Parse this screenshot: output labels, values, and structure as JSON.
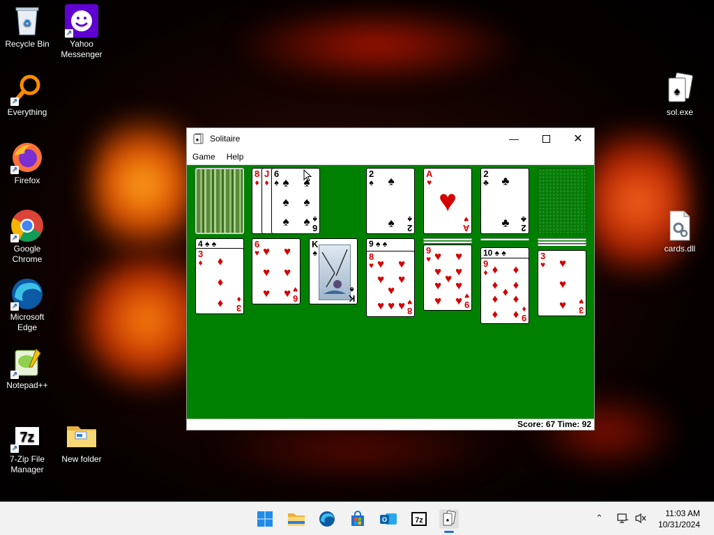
{
  "desktop": {
    "icons": [
      {
        "label": "Recycle Bin"
      },
      {
        "label": "Yahoo Messenger"
      },
      {
        "label": "Everything"
      },
      {
        "label": "Firefox"
      },
      {
        "label": "Google Chrome"
      },
      {
        "label": "Microsoft Edge"
      },
      {
        "label": "Notepad++"
      },
      {
        "label": "7-Zip File Manager"
      },
      {
        "label": "New folder"
      },
      {
        "label": "sol.exe"
      },
      {
        "label": "cards.dll"
      }
    ]
  },
  "window": {
    "title": "Solitaire",
    "menu": [
      "Game",
      "Help"
    ],
    "status": "Score: 67 Time: 92",
    "felt_color": "#008000"
  },
  "cards": {
    "waste": [
      {
        "rank": "8",
        "suit": "♦"
      },
      {
        "rank": "J",
        "suit": "♦"
      },
      {
        "rank": "6",
        "suit": "♠"
      }
    ],
    "foundations": [
      {
        "rank": "2",
        "suit": "♠"
      },
      {
        "rank": "A",
        "suit": "♥"
      },
      {
        "rank": "2",
        "suit": "♣"
      }
    ],
    "tableau": [
      {
        "peek": "4 ♠ ♠",
        "rank": "3",
        "suit": "♦"
      },
      {
        "rank": "6",
        "suit": "♥"
      },
      {
        "rank": "K",
        "suit": "♠"
      },
      {
        "peek": "9 ♠ ♠",
        "rank": "8",
        "suit": "♥"
      },
      {
        "rank": "9",
        "suit": "♥"
      },
      {
        "peek": "10 ♠ ♠",
        "rank": "9",
        "suit": "♦"
      },
      {
        "rank": "3",
        "suit": "♥"
      }
    ]
  },
  "taskbar": {
    "time": "11:03 AM",
    "date": "10/31/2024"
  }
}
